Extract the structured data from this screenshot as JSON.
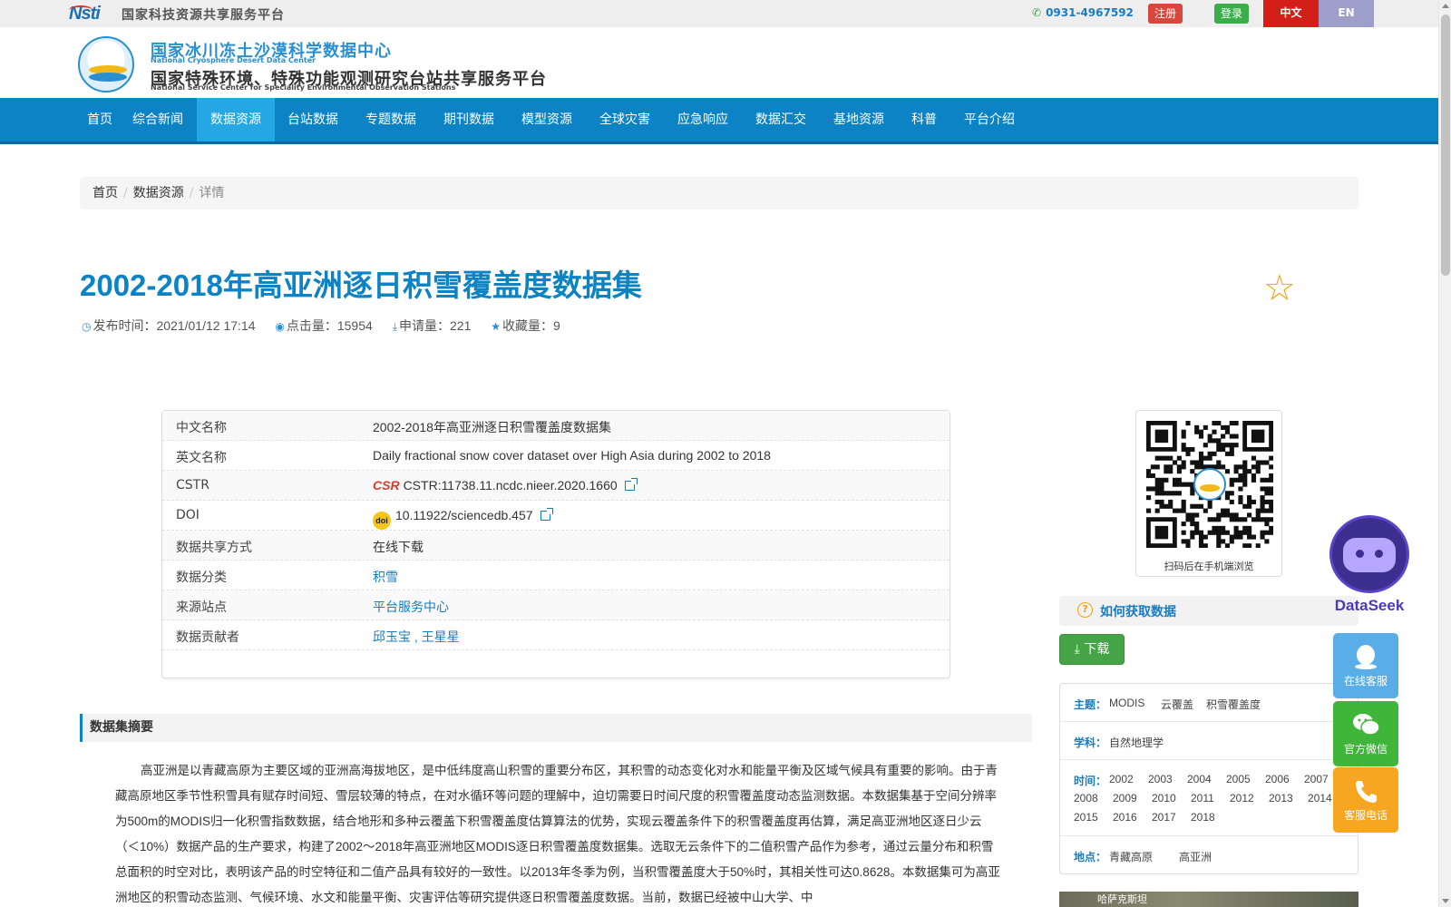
{
  "topbar": {
    "nsti_logo": "Nsti",
    "nsti_text": "国家科技资源共享服务平台",
    "phone": "0931-4967592",
    "register": "注册",
    "login": "登录",
    "lang_cn": "中文",
    "lang_en": "EN",
    "icons": {
      "phone": "phone-icon"
    }
  },
  "header": {
    "title_cn": "国家冰川冻土沙漠科学数据中心",
    "title_en": "National Cryosphere Desert Data Center",
    "subtitle_cn": "国家特殊环境、特殊功能观测研究台站共享服务平台",
    "subtitle_en": "National Service Center for Speciality Environmental Observation Stations"
  },
  "nav": {
    "items": [
      "首页",
      "综合新闻",
      "数据资源",
      "台站数据",
      "专题数据",
      "期刊数据",
      "模型资源",
      "全球灾害",
      "应急响应",
      "数据汇交",
      "基地资源",
      "科普",
      "平台介绍"
    ],
    "active": "数据资源"
  },
  "breadcrumb": [
    "首页",
    "数据资源",
    "详情"
  ],
  "dataset": {
    "title": "2002-2018年高亚洲逐日积雪覆盖度数据集",
    "publish_label": "发布时间：",
    "publish_time": "2021/01/12 17:14",
    "clicks_label": "点击量：",
    "clicks": "15954",
    "applications_label": "申请量：",
    "applications": "221",
    "favorites_label": "收藏量：",
    "favorites": "9"
  },
  "info_table": {
    "rows": [
      {
        "label": "中文名称",
        "value": "2002-2018年高亚洲逐日积雪覆盖度数据集"
      },
      {
        "label": "英文名称",
        "value": "Daily fractional snow cover dataset over High Asia during 2002 to 2018"
      },
      {
        "label": "CSTR",
        "value": "CSTR:11738.11.ncdc.nieer.2020.1660"
      },
      {
        "label": "DOI",
        "value": "10.11922/sciencedb.457"
      },
      {
        "label": "数据共享方式",
        "value": "在线下载"
      },
      {
        "label": "数据分类",
        "value": "积雪"
      },
      {
        "label": "来源站点",
        "value": "平台服务中心"
      },
      {
        "label": "数据贡献者",
        "value": "邱玉宝 , 王星星"
      }
    ],
    "cstr_logo": "CSR",
    "doi_logo": "doi"
  },
  "abstract": {
    "heading": "数据集摘要",
    "text": "高亚洲是以青藏高原为主要区域的亚洲高海拔地区，是中低纬度高山积雪的重要分布区，其积雪的动态变化对水和能量平衡及区域气候具有重要的影响。由于青藏高原地区季节性积雪具有赋存时间短、雪层较薄的特点，在对水循环等问题的理解中，迫切需要日时间尺度的积雪覆盖度动态监测数据。本数据集基于空间分辨率为500m的MODIS归一化积雪指数数据，结合地形和多种云覆盖下积雪覆盖度估算算法的优势，实现云覆盖条件下的积雪覆盖度再估算，满足高亚洲地区逐日少云（＜10%）数据产品的生产要求，构建了2002～2018年高亚洲地区MODIS逐日积雪覆盖度数据集。选取无云条件下的二值积雪产品作为参考，通过云量分布和积雪总面积的时空对比，表明该产品的时空特征和二值产品具有较好的一致性。以2013年冬季为例，当积雪覆盖度大于50%时，其相关性可达0.8628。本数据集可为高亚洲地区的积雪动态监测、气候环境、水文和能量平衡、灾害评估等研究提供逐日积雪覆盖度数据。当前，数据已经被中山大学、中"
  },
  "sidebar": {
    "qr_caption": "扫码后在手机端浏览",
    "how_to": "如何获取数据",
    "download": "下载",
    "subject_label": "主题：",
    "subjects": [
      "MODIS",
      "云覆盖",
      "积雪覆盖度"
    ],
    "discipline_label": "学科：",
    "discipline": "自然地理学",
    "time_label": "时间：",
    "years": [
      "2002",
      "2003",
      "2004",
      "2005",
      "2006",
      "2007",
      "2008",
      "2009",
      "2010",
      "2011",
      "2012",
      "2013",
      "2014",
      "2015",
      "2016",
      "2017",
      "2018"
    ],
    "place_label": "地点：",
    "places": [
      "青藏高原",
      "高亚洲"
    ],
    "map_caption": "哈萨克斯坦"
  },
  "float": {
    "dataseek": "DataSeek",
    "online_service": "在线客服",
    "wechat": "官方微信",
    "phone": "客服电话"
  }
}
